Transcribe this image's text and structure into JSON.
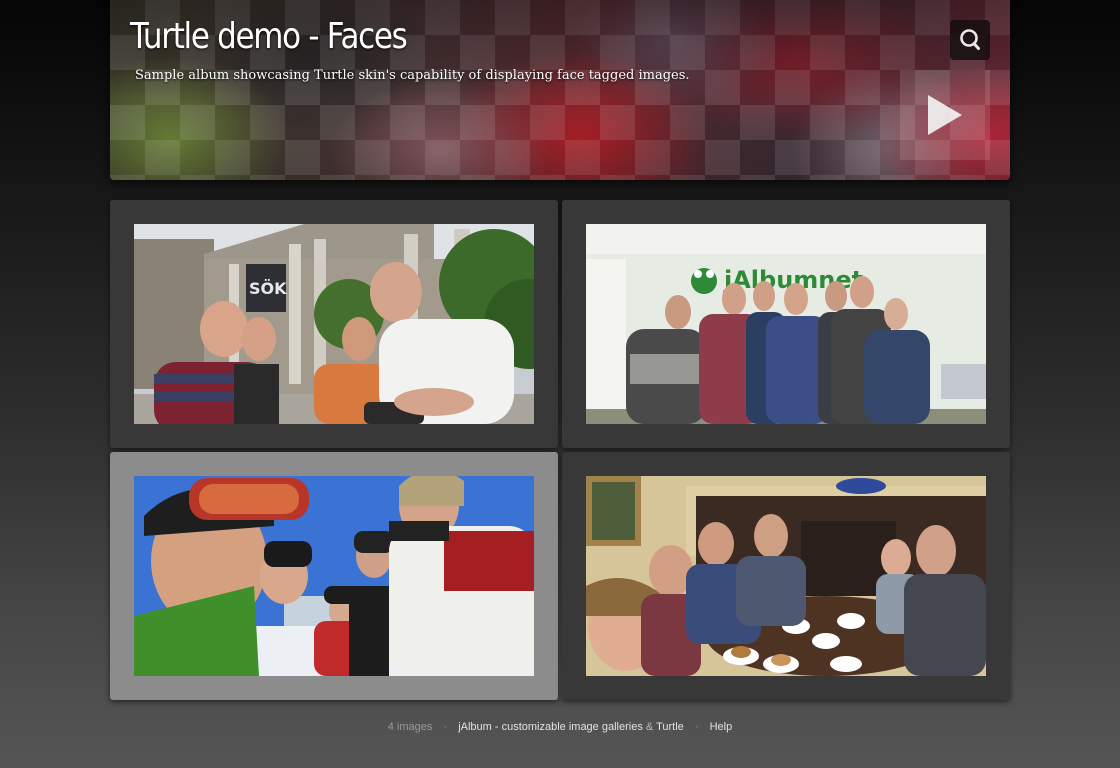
{
  "header": {
    "title": "Turtle demo - Faces",
    "description": "Sample album showcasing Turtle skin's capability of displaying face tagged images.",
    "search_icon": "search-icon",
    "play_icon": "play-icon"
  },
  "thumbnails": [
    {
      "scene": "group selfie in front of a museum building"
    },
    {
      "scene": "team photo in front of jAlbum.net wall",
      "wall_text": "jAlbumnet"
    },
    {
      "scene": "ski selfie in the snow"
    },
    {
      "scene": "group at a table having coffee and cake"
    }
  ],
  "footer": {
    "count": "4 images",
    "separator": "·",
    "jalbum_link": "jAlbum - customizable image galleries",
    "amp": "&",
    "turtle_link": "Turtle",
    "help_link": "Help"
  },
  "colors": {
    "page_bg_top": "#050505",
    "page_bg_bottom": "#555555",
    "thumb_frame": "#383838",
    "thumb_frame_selected": "#8c8c8c"
  }
}
